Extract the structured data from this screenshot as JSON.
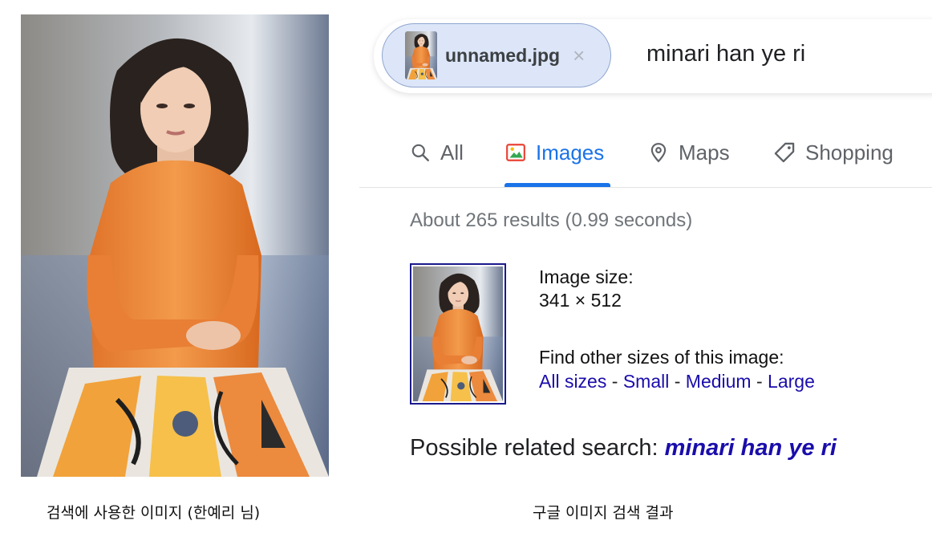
{
  "photo": {
    "alt": "woman in orange knit top"
  },
  "captions": {
    "left": "검색에 사용한 이미지 (한예리 님)",
    "right": "구글 이미지 검색 결과"
  },
  "search": {
    "chip_filename": "unnamed.jpg",
    "chip_close_glyph": "×",
    "query": "minari han ye ri"
  },
  "tabs": [
    {
      "label": "All",
      "icon": "search-icon"
    },
    {
      "label": "Images",
      "icon": "image-icon",
      "active": true
    },
    {
      "label": "Maps",
      "icon": "map-pin-icon"
    },
    {
      "label": "Shopping",
      "icon": "tag-icon"
    }
  ],
  "results": {
    "stats": "About 265 results (0.99 seconds)",
    "image_size_label": "Image size:",
    "image_size_value": "341 × 512",
    "find_other_label": "Find other sizes of this image:",
    "size_links": [
      "All sizes",
      "Small",
      "Medium",
      "Large"
    ],
    "separator": " - ",
    "related_label": "Possible related search: ",
    "related_query": "minari han ye ri"
  },
  "colors": {
    "accent_blue": "#1a73e8",
    "link": "#1a0dab",
    "chip_bg": "#dce6f8",
    "top_orange": "#f08a3c"
  }
}
